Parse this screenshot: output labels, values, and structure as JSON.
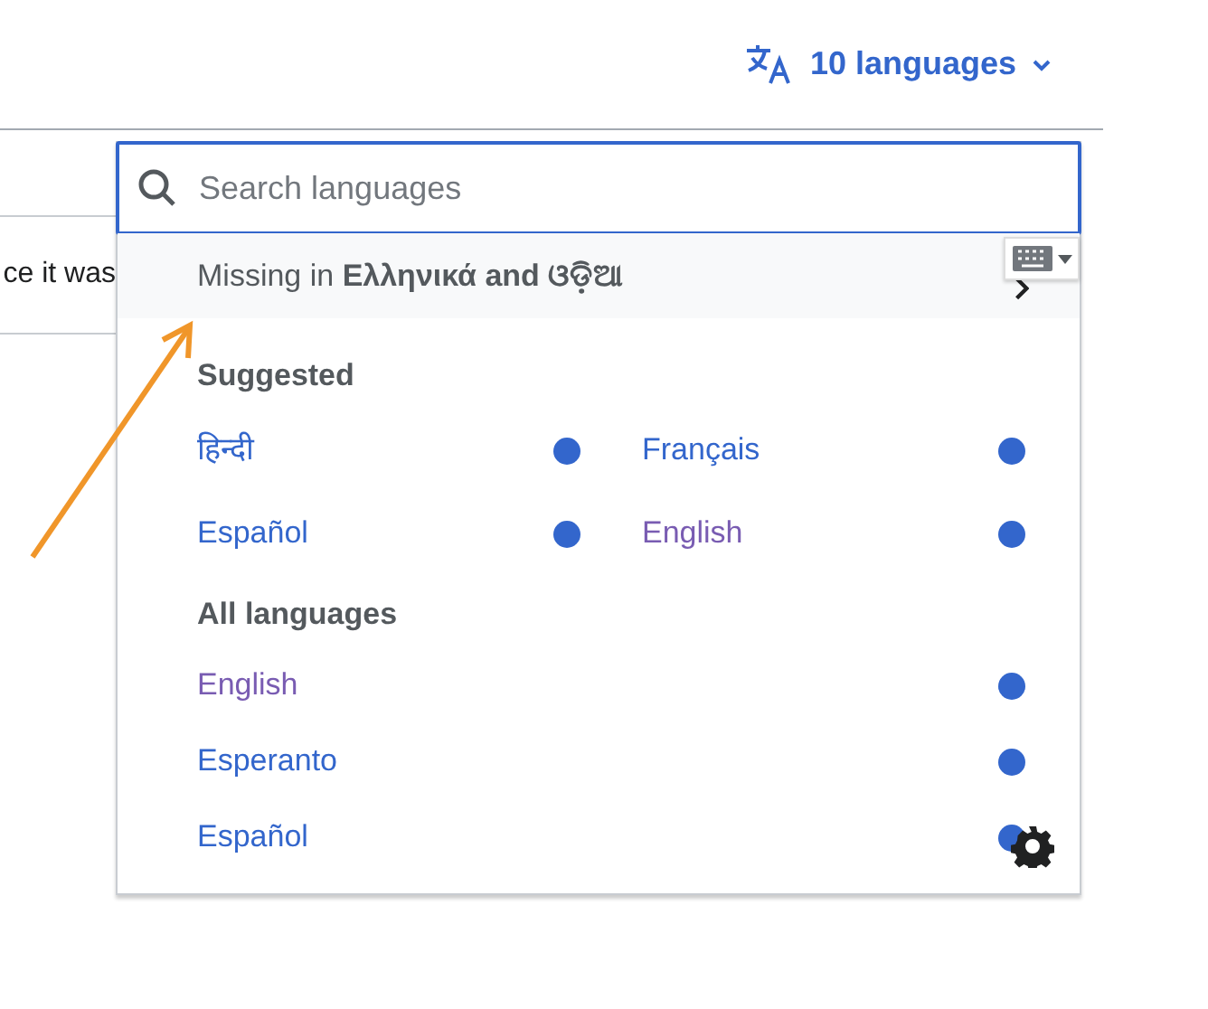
{
  "language_button": {
    "label": "10 languages"
  },
  "page_fragment": {
    "text": "ce it was"
  },
  "popup": {
    "search": {
      "placeholder": "Search languages"
    },
    "missing_notice": "Missing in **Ελληνικά and ଓଡ଼ିଆ**",
    "sections": [
      {
        "title": "Suggested",
        "kind": "grid",
        "languages": [
          {
            "name": "हिन्दी",
            "visited": false
          },
          {
            "name": "Français",
            "visited": false
          },
          {
            "name": "Español",
            "visited": false
          },
          {
            "name": "English",
            "visited": true
          }
        ]
      },
      {
        "title": "All languages",
        "kind": "list",
        "languages": [
          {
            "name": "English",
            "visited": true
          },
          {
            "name": "Esperanto",
            "visited": false
          },
          {
            "name": "Español",
            "visited": false
          }
        ]
      }
    ]
  }
}
